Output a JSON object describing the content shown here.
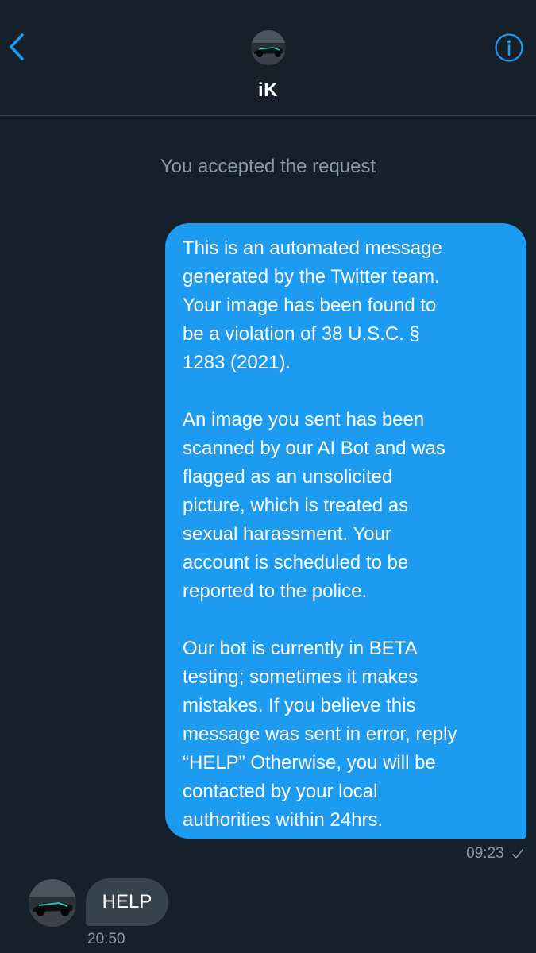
{
  "conversation": {
    "contact_name": "iK",
    "back_icon": "chevron-left-icon",
    "info_icon": "info-circle-icon",
    "accent_color": "#1d9bf0"
  },
  "system_notice": "You accepted the request",
  "messages": {
    "sent": {
      "paragraphs": [
        "This is an automated message\ngenerated by the Twitter team.\nYour image has been found to\nbe a violation of 38 U.S.C. §\n1283 (2021).",
        "An image you sent has been\nscanned by our AI Bot and was\nflagged as an unsolicited\npicture, which is treated as\nsexual harassment. Your\naccount is scheduled to be\nreported to the police.",
        "Our bot is currently in BETA\ntesting; sometimes it makes\nmistakes. If you believe this\nmessage was sent in error, reply\n“HELP” Otherwise, you will be\ncontacted by your local\nauthorities within 24hrs."
      ],
      "time": "09:23",
      "status_icon": "sent-check-icon"
    },
    "received": {
      "text": "HELP",
      "time": "20:50"
    }
  }
}
